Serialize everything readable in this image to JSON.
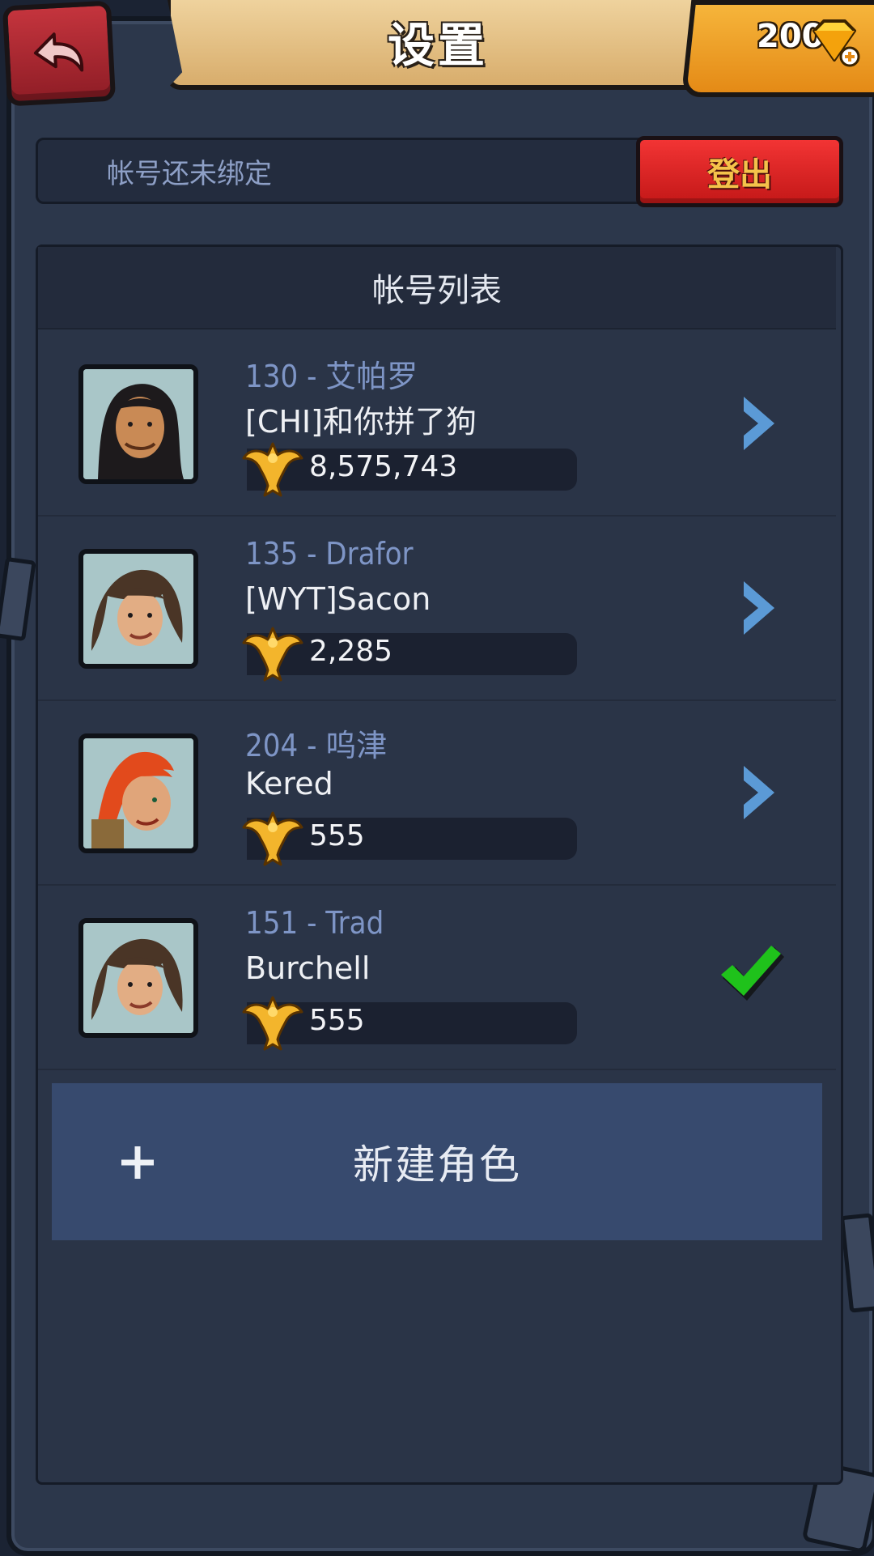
{
  "header": {
    "title": "设置",
    "currency_amount": "200",
    "back_icon": "back-arrow-icon",
    "currency_icon": "gem-plus-icon"
  },
  "account": {
    "status_text": "帐号还未绑定",
    "logout_label": "登出"
  },
  "account_list": {
    "title": "帐号列表",
    "rows": [
      {
        "server": "130 - 艾帕罗",
        "name": "[CHI]和你拼了狗",
        "power": "8,575,743",
        "action": "chevron-right-icon",
        "avatar": "warrior-portrait"
      },
      {
        "server": "135 - Drafor",
        "name": "[WYT]Sacon",
        "power": "2,285",
        "action": "chevron-right-icon",
        "avatar": "ranger-portrait"
      },
      {
        "server": "204 - 呜津",
        "name": "Kered",
        "power": "555",
        "action": "chevron-right-icon",
        "avatar": "redhair-portrait"
      },
      {
        "server": "151 - Trad",
        "name": "Burchell",
        "power": "555",
        "action": "checkmark-icon",
        "avatar": "ranger-portrait"
      }
    ]
  },
  "new_character": {
    "label": "新建角色"
  },
  "colors": {
    "background": "#2c374b",
    "accent_blue": "#7e95c6",
    "logout_red": "#e02424",
    "title_banner": "#e6c287",
    "currency_gold": "#f2a22c",
    "check_green": "#1fc21b"
  }
}
